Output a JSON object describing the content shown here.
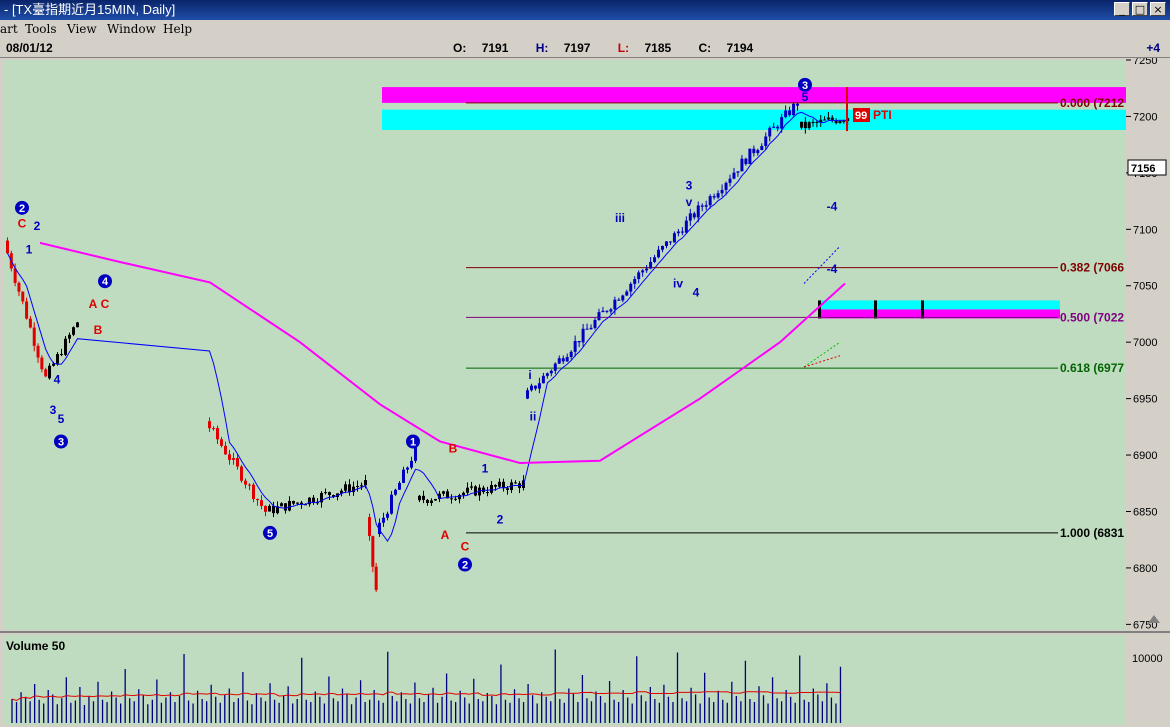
{
  "window": {
    "title": "- [TX臺指期近月15MIN, Daily]",
    "buttons": [
      "_",
      "□",
      "×"
    ]
  },
  "menu": {
    "items": [
      "art",
      "Tools",
      "View",
      "Window",
      "Help"
    ]
  },
  "info": {
    "date": "08/01/12",
    "o_label": "O:",
    "o_value": "7191",
    "h_label": "H:",
    "h_value": "7197",
    "l_label": "L:",
    "l_value": "7185",
    "c_label": "C:",
    "c_value": "7194",
    "plus": "+4"
  },
  "chart_data": {
    "type": "line",
    "ylim": [
      6745,
      7250
    ],
    "y_ticks": [
      7250,
      7200,
      7150,
      7100,
      7050,
      7000,
      6950,
      6900,
      6850,
      6800,
      6750
    ],
    "current_price_label": "7156",
    "current_price": 7156,
    "volume_label": "Volume 50",
    "volume_ticks": [
      "10000"
    ],
    "fib_levels": [
      {
        "label": "0.000 (7212",
        "value": 7212,
        "color": "#800000"
      },
      {
        "label": "0.382 (7066",
        "value": 7066,
        "color": "#800000"
      },
      {
        "label": "0.500 (7022",
        "value": 7022,
        "color": "#800080"
      },
      {
        "label": "0.618 (6977",
        "value": 6977,
        "color": "#006400"
      },
      {
        "label": "1.000 (6831",
        "value": 6831,
        "color": "#000000"
      }
    ],
    "zones": [
      {
        "from": 7212,
        "to": 7226,
        "color": "#ff00ff"
      },
      {
        "from": 7188,
        "to": 7206,
        "color": "#00ffff"
      },
      {
        "from": 7029,
        "to": 7037,
        "color": "#00ffff"
      },
      {
        "from": 7021,
        "to": 7029,
        "color": "#ff00ff"
      }
    ],
    "price_tag": {
      "value": "99",
      "text": "PTI"
    },
    "wave_labels": [
      {
        "text": "2",
        "circle": true,
        "color": "#0000c0"
      },
      {
        "text": "C",
        "color": "#e00000"
      },
      {
        "text": "2",
        "color": "#0000c0"
      },
      {
        "text": "1",
        "color": "#0000c0"
      },
      {
        "text": "4",
        "circle": true,
        "color": "#0000c0"
      },
      {
        "text": "A",
        "color": "#e00000"
      },
      {
        "text": "C",
        "color": "#e00000"
      },
      {
        "text": "B",
        "color": "#e00000"
      },
      {
        "text": "4",
        "color": "#0000c0"
      },
      {
        "text": "3",
        "color": "#0000c0"
      },
      {
        "text": "5",
        "color": "#0000c0"
      },
      {
        "text": "3",
        "circle": true,
        "color": "#0000c0"
      },
      {
        "text": "5",
        "circle": true,
        "color": "#0000c0"
      },
      {
        "text": "1",
        "circle": true,
        "color": "#0000c0"
      },
      {
        "text": "B",
        "color": "#e00000"
      },
      {
        "text": "A",
        "color": "#e00000"
      },
      {
        "text": "C",
        "color": "#e00000"
      },
      {
        "text": "2",
        "circle": true,
        "color": "#0000c0"
      },
      {
        "text": "1",
        "color": "#0000c0"
      },
      {
        "text": "2",
        "color": "#0000c0"
      },
      {
        "text": "i",
        "color": "#0000c0"
      },
      {
        "text": "ii",
        "color": "#0000c0"
      },
      {
        "text": "iii",
        "color": "#0000c0"
      },
      {
        "text": "iv",
        "color": "#0000c0"
      },
      {
        "text": "4",
        "color": "#0000c0"
      },
      {
        "text": "3",
        "color": "#0000c0"
      },
      {
        "text": "v",
        "color": "#0000c0"
      },
      {
        "text": "3",
        "circle": true,
        "color": "#0000c0"
      },
      {
        "text": "5",
        "color": "#0000c0"
      },
      {
        "text": "-4",
        "color": "#0000c0"
      },
      {
        "text": "-4",
        "color": "#0000c0"
      }
    ],
    "segments": [
      {
        "name": "wave-down-2-3",
        "color": "red",
        "from": 7090,
        "to": 6968
      },
      {
        "name": "wave-up-3-4",
        "color": "black",
        "from": 6968,
        "to": 7018
      },
      {
        "name": "wave-down-4-5",
        "color": "red",
        "from": 6930,
        "to": 6850
      },
      {
        "name": "wave-consolidation",
        "color": "black",
        "from": 6850,
        "to": 6875
      },
      {
        "name": "wave-drop",
        "color": "red",
        "from": 6845,
        "to": 6780
      },
      {
        "name": "wave-up-1",
        "color": "blue",
        "from": 6830,
        "to": 6905
      },
      {
        "name": "wave-abc",
        "color": "black",
        "from": 6860,
        "to": 6875
      },
      {
        "name": "wave-up-3",
        "color": "blue",
        "from": 6950,
        "to": 7212
      },
      {
        "name": "wave-top",
        "color": "black",
        "from": 7190,
        "to": 7200
      }
    ],
    "volume": [
      3200,
      2800,
      4100,
      3500,
      2900,
      5200,
      3100,
      2600,
      4400,
      3800,
      2500,
      3300,
      6100,
      2700,
      3000,
      4800,
      2400,
      3600,
      2900,
      5500,
      3100,
      2800,
      4200,
      3400,
      2600,
      7200,
      3300,
      2900,
      4500,
      3700,
      2500,
      3100,
      5800,
      2700,
      3400,
      4100,
      2800,
      3600,
      9200,
      3000,
      2600,
      4300,
      3200,
      2900,
      5100,
      3500,
      2700,
      3800,
      4600,
      2800,
      3300,
      6800,
      3000,
      2500,
      4000,
      3400,
      2900,
      5300,
      3100,
      2700,
      3700,
      4900,
      2600,
      3200,
      8700,
      3100,
      2800,
      4200,
      3500,
      2600,
      6200,
      3300,
      2900,
      4600,
      3800,
      2500,
      3400,
      5700,
      2800,
      3100,
      4400,
      3000,
      2700,
      9500,
      3600,
      2900,
      4100,
      3200,
      2600,
      5400,
      3300,
      2800,
      3900,
      4700,
      2700,
      3500,
      6600,
      3000,
      2800,
      4300,
      3400,
      2600,
      5900,
      3200,
      2900,
      4000,
      3600,
      2500,
      7800,
      3100,
      2700,
      4500,
      3300,
      2800,
      5200,
      3700,
      2600,
      4100,
      3500,
      2900,
      9800,
      3200,
      2700,
      4600,
      3900,
      2800,
      6400,
      3300,
      2900,
      4200,
      3600,
      2700,
      5600,
      3100,
      2800,
      4400,
      3400,
      2600,
      8900,
      3700,
      2900,
      4800,
      3200,
      2700,
      5100,
      3500,
      2800,
      9400,
      3300,
      2900,
      4700,
      3800,
      2600,
      6700,
      3400,
      2800,
      4300,
      3100,
      2700,
      5500,
      3600,
      2900,
      8300,
      3200,
      2800,
      4900,
      3700,
      2600,
      6100,
      3300,
      2900,
      4400,
      3500,
      2700,
      9000,
      3100,
      2800,
      4600,
      3800,
      2900,
      5300,
      3400,
      2600,
      7500
    ],
    "volume_max": 10000
  }
}
